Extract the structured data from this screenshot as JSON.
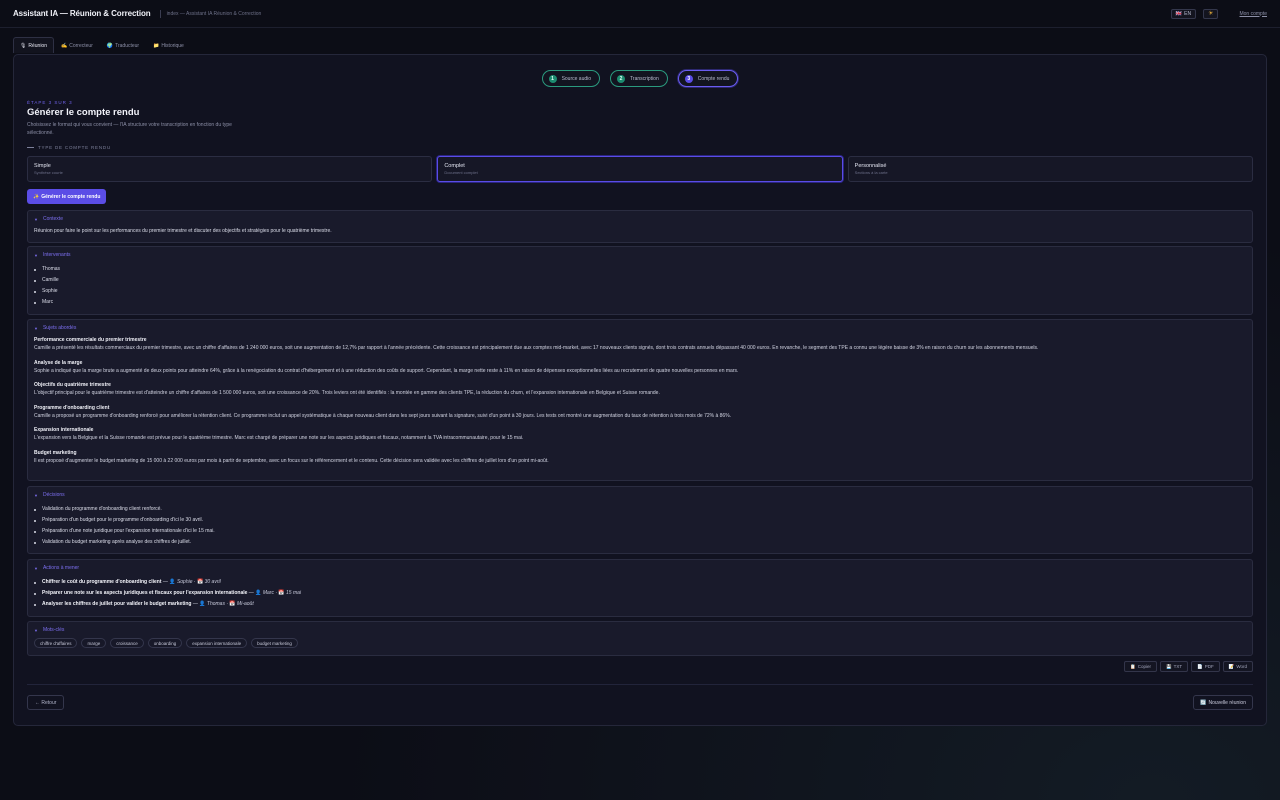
{
  "header": {
    "title": "Assistant IA — Réunion & Correction",
    "subtitle": "index — Assistant IA Réunion & Correction",
    "language_flag": "🇬🇧",
    "language": "EN",
    "theme_icon": "☀",
    "account": "Mon compte"
  },
  "tabs": [
    {
      "icon": "🎙",
      "label": "Réunion"
    },
    {
      "icon": "✍️",
      "label": "Correcteur"
    },
    {
      "icon": "🌍",
      "label": "Traducteur"
    },
    {
      "icon": "📁",
      "label": "Historique"
    }
  ],
  "stepper": [
    {
      "num": "1",
      "label": "Source audio"
    },
    {
      "num": "2",
      "label": "Transcription"
    },
    {
      "num": "3",
      "label": "Compte rendu"
    }
  ],
  "step_page": {
    "eyebrow": "ÉTAPE 3 SUR 3",
    "title": "Générer le compte rendu",
    "description": "Choisissez le format qui vous convient — l'IA structure votre transcription en fonction du type sélectionné."
  },
  "report_type": {
    "label": "TYPE DE COMPTE RENDU",
    "options": [
      {
        "title": "Simple",
        "subtitle": "Synthèse courte"
      },
      {
        "title": "Complet",
        "subtitle": "Document complet"
      },
      {
        "title": "Personnalisé",
        "subtitle": "Sections à la carte"
      }
    ],
    "selected": "Complet"
  },
  "generate_button": {
    "icon": "✨",
    "label": "Générer le compte rendu"
  },
  "sections": {
    "context": {
      "title": "Contexte",
      "text": "Réunion pour faire le point sur les performances du premier trimestre et discuter des objectifs et stratégies pour le quatrième trimestre."
    },
    "participants": {
      "title": "Intervenants",
      "items": [
        "Thomas",
        "Camille",
        "Sophie",
        "Marc"
      ]
    },
    "topics": {
      "title": "Sujets abordés",
      "items": [
        {
          "title": "Performance commerciale du premier trimestre",
          "text": "Camille a présenté les résultats commerciaux du premier trimestre, avec un chiffre d'affaires de 1 240 000 euros, soit une augmentation de 12,7% par rapport à l'année précédente. Cette croissance est principalement due aux comptes mid-market, avec 17 nouveaux clients signés, dont trois contrats annuels dépassant 40 000 euros. En revanche, le segment des TPE a connu une légère baisse de 3% en raison du churn sur les abonnements mensuels."
        },
        {
          "title": "Analyse de la marge",
          "text": "Sophie a indiqué que la marge brute a augmenté de deux points pour atteindre 64%, grâce à la renégociation du contrat d'hébergement et à une réduction des coûts de support. Cependant, la marge nette reste à 11% en raison de dépenses exceptionnelles liées au recrutement de quatre nouvelles personnes en mars."
        },
        {
          "title": "Objectifs du quatrième trimestre",
          "text": "L'objectif principal pour le quatrième trimestre est d'atteindre un chiffre d'affaires de 1 500 000 euros, soit une croissance de 20%. Trois leviers ont été identifiés : la montée en gamme des clients TPE, la réduction du churn, et l'expansion internationale en Belgique et Suisse romande."
        },
        {
          "title": "Programme d'onboarding client",
          "text": "Camille a proposé un programme d'onboarding renforcé pour améliorer la rétention client. Ce programme inclut un appel systématique à chaque nouveau client dans les sept jours suivant la signature, suivi d'un point à 30 jours. Les tests ont montré une augmentation du taux de rétention à trois mois de 72% à 86%."
        },
        {
          "title": "Expansion internationale",
          "text": "L'expansion vers la Belgique et la Suisse romande est prévue pour le quatrième trimestre. Marc est chargé de préparer une note sur les aspects juridiques et fiscaux, notamment la TVA intracommunautaire, pour le 15 mai."
        },
        {
          "title": "Budget marketing",
          "text": "Il est proposé d'augmenter le budget marketing de 15 000 à 22 000 euros par mois à partir de septembre, avec un focus sur le référencement et le contenu. Cette décision sera validée avec les chiffres de juillet lors d'un point mi-août."
        }
      ]
    },
    "decisions": {
      "title": "Décisions",
      "items": [
        "Validation du programme d'onboarding client renforcé.",
        "Préparation d'un budget pour le programme d'onboarding d'ici le 30 avril.",
        "Préparation d'une note juridique pour l'expansion internationale d'ici le 15 mai.",
        "Validation du budget marketing après analyse des chiffres de juillet."
      ]
    },
    "actions": {
      "title": "Actions à mener",
      "items": [
        {
          "task": "Chiffrer le coût du programme d'onboarding client",
          "person": "Sophie",
          "due": "30 avril"
        },
        {
          "task": "Préparer une note sur les aspects juridiques et fiscaux pour l'expansion internationale",
          "person": "Marc",
          "due": "15 mai"
        },
        {
          "task": "Analyser les chiffres de juillet pour valider le budget marketing",
          "person": "Thomas",
          "due": "Mi-août"
        }
      ]
    },
    "keywords": {
      "title": "Mots-clés",
      "items": [
        "chiffre d'affaires",
        "marge",
        "croissance",
        "onboarding",
        "expansion internationale",
        "budget marketing"
      ]
    }
  },
  "export": [
    {
      "icon": "📋",
      "label": "Copier"
    },
    {
      "icon": "💾",
      "label": "TXT"
    },
    {
      "icon": "📄",
      "label": "PDF"
    },
    {
      "icon": "📝",
      "label": "Word"
    }
  ],
  "footer": {
    "back_label": "← Retour",
    "new_label": "Nouvelle réunion",
    "new_icon": "🔄"
  }
}
